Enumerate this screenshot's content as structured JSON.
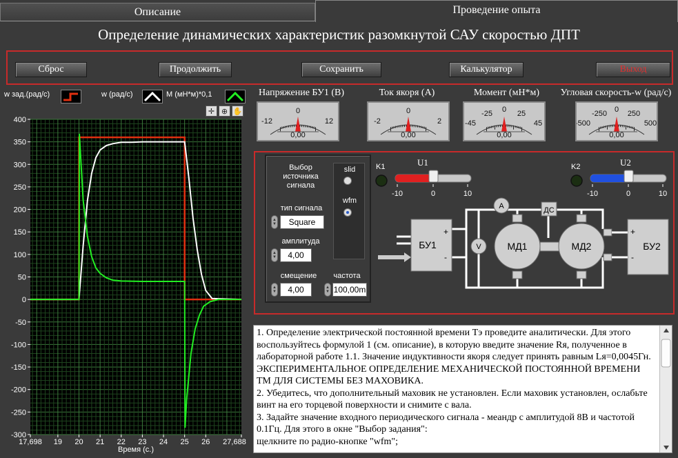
{
  "tabs": {
    "description": "Описание",
    "experiment": "Проведение опыта"
  },
  "title": "Определение динамических характеристик разомкнутой САУ скоростью ДПТ",
  "buttons": {
    "reset": "Сброс",
    "continue": "Продолжить",
    "save": "Сохранить",
    "calculator": "Калькулятор",
    "exit": "Выход"
  },
  "legend": {
    "setpoint": "w зад.(рад/с)",
    "speed": "w (рад/с)",
    "moment": "М (мН*м)*0,1"
  },
  "colors": {
    "setpoint": "#e03010",
    "speed": "#ffffff",
    "moment": "#22ee22",
    "accent_red": "#c82a2a"
  },
  "chart_data": {
    "type": "line",
    "xlabel": "Время (с.)",
    "xlim": [
      17.698,
      27.688
    ],
    "ylim": [
      -300,
      400
    ],
    "x_ticks": [
      "17,698",
      "19",
      "20",
      "21",
      "22",
      "23",
      "24",
      "25",
      "26",
      "27,688"
    ],
    "y_ticks": [
      "400",
      "350",
      "300",
      "250",
      "200",
      "150",
      "100",
      "50",
      "0",
      "-50",
      "-100",
      "-150",
      "-200",
      "-250",
      "-300"
    ],
    "series": [
      {
        "name": "w зад.(рад/с)",
        "x": [
          17.698,
          20.0,
          20.0,
          25.0,
          25.0,
          27.688
        ],
        "y": [
          0,
          0,
          360,
          360,
          0,
          0
        ]
      },
      {
        "name": "w (рад/с)",
        "x": [
          17.698,
          20.0,
          20.2,
          20.4,
          20.6,
          20.8,
          21.0,
          21.3,
          21.6,
          22.0,
          22.5,
          23.0,
          25.0,
          25.2,
          25.4,
          25.6,
          25.8,
          26.0,
          26.3,
          27.688
        ],
        "y": [
          0,
          0,
          120,
          220,
          280,
          315,
          332,
          342,
          346,
          349,
          349,
          350,
          350,
          270,
          180,
          110,
          55,
          20,
          2,
          0
        ]
      },
      {
        "name": "М (мН*м)*0,1",
        "x": [
          17.698,
          20.0,
          20.02,
          20.1,
          20.2,
          20.4,
          20.6,
          20.8,
          21.0,
          21.3,
          21.6,
          22.0,
          23.0,
          25.0,
          25.02,
          25.1,
          25.3,
          25.5,
          25.7,
          25.9,
          26.2,
          26.6,
          27.688
        ],
        "y": [
          0,
          0,
          368,
          300,
          220,
          140,
          95,
          70,
          58,
          48,
          43,
          41,
          40,
          40,
          -285,
          -220,
          -120,
          -65,
          -35,
          -15,
          -5,
          0,
          0
        ]
      }
    ]
  },
  "meters": [
    {
      "label": "Напряжение БУ1 (В)",
      "ticks": [
        "-12",
        "0",
        "12"
      ],
      "value": "0,00",
      "reading": 0
    },
    {
      "label": "Ток якоря (А)",
      "ticks": [
        "-2",
        "0",
        "2"
      ],
      "value": "0,00",
      "reading": 0
    },
    {
      "label": "Момент (мН*м)",
      "ticks": [
        "-45",
        "-25",
        "0",
        "25",
        "45"
      ],
      "value": "0,00",
      "reading": 0
    },
    {
      "label": "Угловая скорость-w (рад/с)",
      "ticks": [
        "-500",
        "-250",
        "0",
        "250",
        "500"
      ],
      "value": "0,00",
      "reading": 0
    }
  ],
  "source": {
    "heading": "Выбор источника сигнала",
    "slid": "slid",
    "wfm": "wfm",
    "signal_type_label": "тип сигнала",
    "signal_type": "Square",
    "amplitude_label": "амплитуда",
    "amplitude": "4,00",
    "offset_label": "смещение",
    "offset": "4,00",
    "frequency_label": "частота",
    "frequency": "100,00m"
  },
  "sliders": {
    "k1": "K1",
    "u1": "U1",
    "u1_ticks": [
      "-10",
      "0",
      "10"
    ],
    "u1_value": 0,
    "k2": "K2",
    "u2": "U2",
    "u2_ticks": [
      "-10",
      "0",
      "10"
    ],
    "u2_value": 0
  },
  "circuit": {
    "bu1": "БУ1",
    "bu2": "БУ2",
    "md1": "МД1",
    "md2": "МД2",
    "ammeter": "A",
    "voltmeter": "V",
    "ds": "ДС",
    "plus": "+",
    "minus": "-"
  },
  "instructions": [
    "1. Определение электрической постоянной времени Тэ проведите аналитически. Для этого воспользуйтесь формулой 1 (см. описание), в которую введите значение Rя, полученное в лабораторной работе 1.1. Значение индуктивности якоря следует принять равным Lя=0,0045Гн.",
    "ЭКСПЕРИМЕНТАЛЬНОЕ ОПРЕДЕЛЕНИЕ МЕХАНИЧЕСКОЙ ПОСТОЯННОЙ ВРЕМЕНИ ТМ ДЛЯ СИСТЕМЫ БЕЗ МАХОВИКА.",
    "2. Убедитесь, что дополнительный маховик не установлен. Если маховик установлен, ослабьте винт на его торцевой поверхности и снимите с вала.",
    "3. Задайте значение входного периодического сигнала - меандр с амплитудой 8В и частотой 0.1Гц. Для этого в окне \"Выбор задания\":",
    "щелкните по радио-кнопке \"wfm\";"
  ]
}
